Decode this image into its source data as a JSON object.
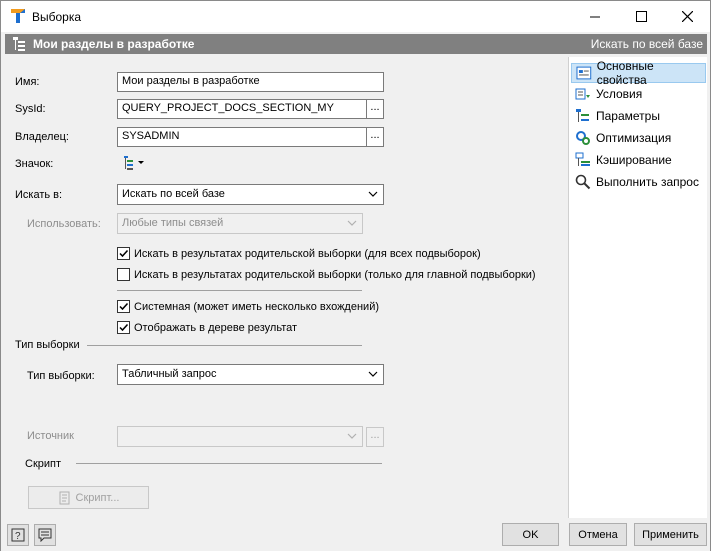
{
  "window": {
    "title": "Выборка"
  },
  "header": {
    "title": "Мои разделы в разработке",
    "scope": "Искать по всей базе"
  },
  "form": {
    "name_label": "Имя:",
    "name_value": "Мои разделы в разработке",
    "sysid_label": "SysId:",
    "sysid_value": "QUERY_PROJECT_DOCS_SECTION_MY",
    "owner_label": "Владелец:",
    "owner_value": "SYSADMIN",
    "icon_label": "Значок:",
    "ellipsis": "...",
    "search_in_label": "Искать в:",
    "search_in_value": "Искать по всей базе",
    "use_label": "Использовать:",
    "use_value": "Любые типы связей",
    "cb_parent_all": "Искать в результатах родительской выборки (для всех подвыборок)",
    "cb_parent_all_checked": true,
    "cb_parent_main": "Искать в результатах родительской выборки (только для главной подвыборки)",
    "cb_parent_main_checked": false,
    "cb_system": "Системная (может иметь несколько вхождений)",
    "cb_system_checked": true,
    "cb_show_tree": "Отображать в дереве результат",
    "cb_show_tree_checked": true,
    "type_section": "Тип выборки",
    "type_label": "Тип выборки:",
    "type_value": "Табличный запрос",
    "source_label": "Источник",
    "source_value": "",
    "script_section": "Скрипт",
    "script_button": "Скрипт..."
  },
  "sidebar": {
    "items": [
      {
        "label": "Основные свойства",
        "icon": "properties-icon",
        "selected": true
      },
      {
        "label": "Условия",
        "icon": "conditions-icon",
        "selected": false
      },
      {
        "label": "Параметры",
        "icon": "parameters-icon",
        "selected": false
      },
      {
        "label": "Оптимизация",
        "icon": "optimization-icon",
        "selected": false
      },
      {
        "label": "Кэширование",
        "icon": "caching-icon",
        "selected": false
      },
      {
        "label": "Выполнить запрос",
        "icon": "search-icon",
        "selected": false
      }
    ]
  },
  "buttons": {
    "ok": "OK",
    "cancel": "Отмена",
    "apply": "Применить"
  },
  "colors": {
    "header_bg": "#808080",
    "selection_bg": "#cce4f7",
    "accent": "#1e6fcf"
  }
}
